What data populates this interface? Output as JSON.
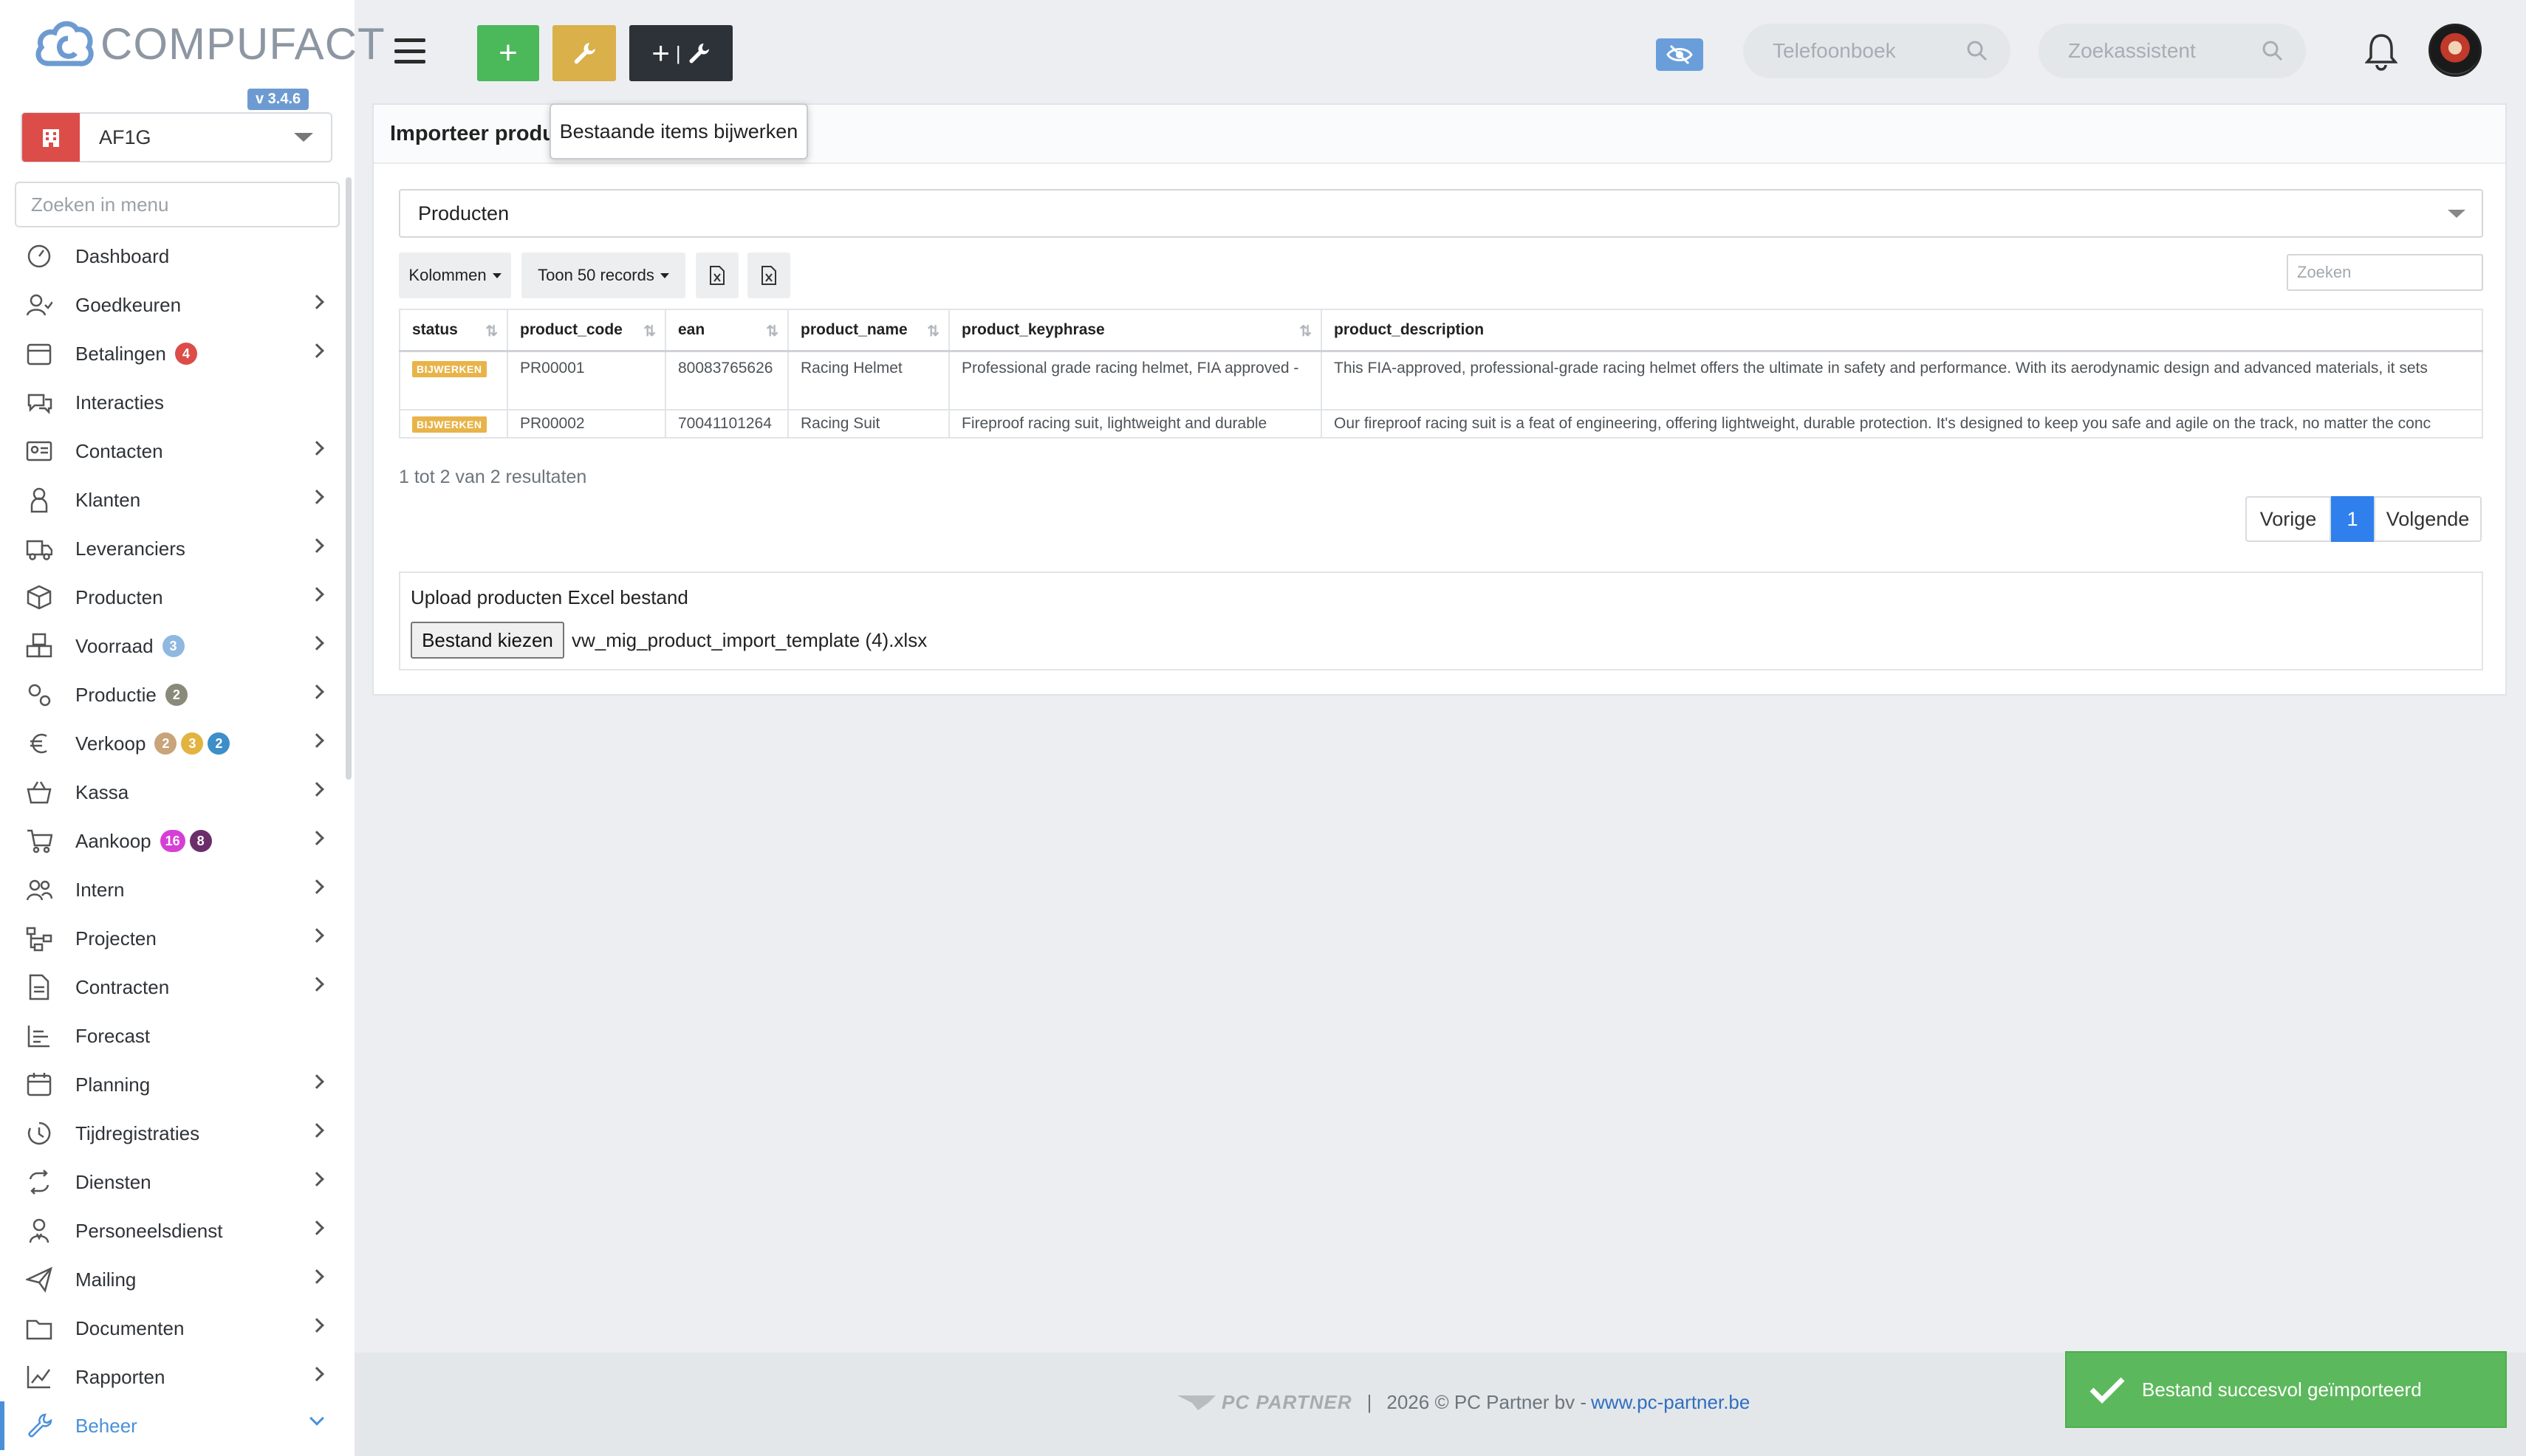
{
  "app": {
    "logo_text": "COMPUFACT",
    "version": "v 3.4.6",
    "company": "AF1G",
    "menu_search_placeholder": "Zoeken in menu"
  },
  "sidebar": {
    "items": [
      {
        "label": "Dashboard",
        "icon": "dashboard-icon",
        "chevron": false
      },
      {
        "label": "Goedkeuren",
        "icon": "user-check-icon",
        "chevron": true
      },
      {
        "label": "Betalingen",
        "icon": "calendar-icon",
        "chevron": true,
        "badges": [
          {
            "text": "4",
            "color": "#dc4d49"
          }
        ]
      },
      {
        "label": "Interacties",
        "icon": "chat-icon",
        "chevron": false
      },
      {
        "label": "Contacten",
        "icon": "contact-card-icon",
        "chevron": true
      },
      {
        "label": "Klanten",
        "icon": "customer-icon",
        "chevron": true
      },
      {
        "label": "Leveranciers",
        "icon": "truck-icon",
        "chevron": true
      },
      {
        "label": "Producten",
        "icon": "box-icon",
        "chevron": true
      },
      {
        "label": "Voorraad",
        "icon": "boxes-icon",
        "chevron": true,
        "badges": [
          {
            "text": "3",
            "color": "#8fb8e0"
          }
        ]
      },
      {
        "label": "Productie",
        "icon": "gears-icon",
        "chevron": true,
        "badges": [
          {
            "text": "2",
            "color": "#8a8a7a"
          }
        ]
      },
      {
        "label": "Verkoop",
        "icon": "euro-icon",
        "chevron": true,
        "badges": [
          {
            "text": "2",
            "color": "#c9a37a"
          },
          {
            "text": "3",
            "color": "#e2b340"
          },
          {
            "text": "2",
            "color": "#3d8ec9"
          }
        ]
      },
      {
        "label": "Kassa",
        "icon": "basket-icon",
        "chevron": true
      },
      {
        "label": "Aankoop",
        "icon": "cart-icon",
        "chevron": true,
        "badges": [
          {
            "text": "16",
            "color": "#d63fd6"
          },
          {
            "text": "8",
            "color": "#6b2e6b"
          }
        ]
      },
      {
        "label": "Intern",
        "icon": "users-icon",
        "chevron": true
      },
      {
        "label": "Projecten",
        "icon": "project-icon",
        "chevron": true
      },
      {
        "label": "Contracten",
        "icon": "contract-icon",
        "chevron": true
      },
      {
        "label": "Forecast",
        "icon": "forecast-icon",
        "chevron": false
      },
      {
        "label": "Planning",
        "icon": "planning-icon",
        "chevron": true
      },
      {
        "label": "Tijdregistraties",
        "icon": "clock-icon",
        "chevron": true
      },
      {
        "label": "Diensten",
        "icon": "repeat-icon",
        "chevron": true
      },
      {
        "label": "Personeelsdienst",
        "icon": "staff-icon",
        "chevron": true
      },
      {
        "label": "Mailing",
        "icon": "paper-plane-icon",
        "chevron": true
      },
      {
        "label": "Documenten",
        "icon": "folder-icon",
        "chevron": true
      },
      {
        "label": "Rapporten",
        "icon": "chart-line-icon",
        "chevron": true
      },
      {
        "label": "Beheer",
        "icon": "wrench-icon",
        "chevron": true,
        "active": true
      }
    ]
  },
  "header": {
    "search1_placeholder": "Telefoonboek",
    "search2_placeholder": "Zoekassistent",
    "btn_add_symbol": "+"
  },
  "tooltip": {
    "text": "Bestaande items bijwerken"
  },
  "card": {
    "title": "Importeer producten",
    "select_value": "Producten",
    "toolbar": {
      "columns_label": "Kolommen",
      "records_label": "Toon 50 records"
    },
    "search_placeholder": "Zoeken",
    "table": {
      "headers": [
        "status",
        "product_code",
        "ean",
        "product_name",
        "product_keyphrase",
        "product_description"
      ],
      "rows": [
        {
          "status": "BIJWERKEN",
          "product_code": "PR00001",
          "ean": "80083765626",
          "product_name": "Racing Helmet",
          "product_keyphrase": "Professional grade racing helmet, FIA approved -",
          "product_description": "This FIA-approved, professional-grade racing helmet offers the ultimate in safety and performance. With its aerodynamic design and advanced materials, it sets"
        },
        {
          "status": "BIJWERKEN",
          "product_code": "PR00002",
          "ean": "70041101264",
          "product_name": "Racing Suit",
          "product_keyphrase": "Fireproof racing suit, lightweight and durable",
          "product_description": "Our fireproof racing suit is a feat of engineering, offering lightweight, durable protection. It's designed to keep you safe and agile on the track, no matter the conc"
        }
      ]
    },
    "results_text": "1 tot 2 van 2 resultaten",
    "pager": {
      "prev": "Vorige",
      "current": "1",
      "next": "Volgende"
    },
    "upload": {
      "title": "Upload producten Excel bestand",
      "button": "Bestand kiezen",
      "filename": "vw_mig_product_import_template (4).xlsx"
    }
  },
  "footer": {
    "logo": "PC PARTNER",
    "separator": "|",
    "copyright": "2026 © PC Partner bv -",
    "link": "www.pc-partner.be"
  },
  "toast": {
    "text": "Bestand succesvol geïmporteerd"
  },
  "colors": {
    "accent": "#4a90d9",
    "success": "#5cb85c",
    "add": "#4bb85a",
    "tool": "#d9b04a",
    "dark": "#2c3238"
  }
}
